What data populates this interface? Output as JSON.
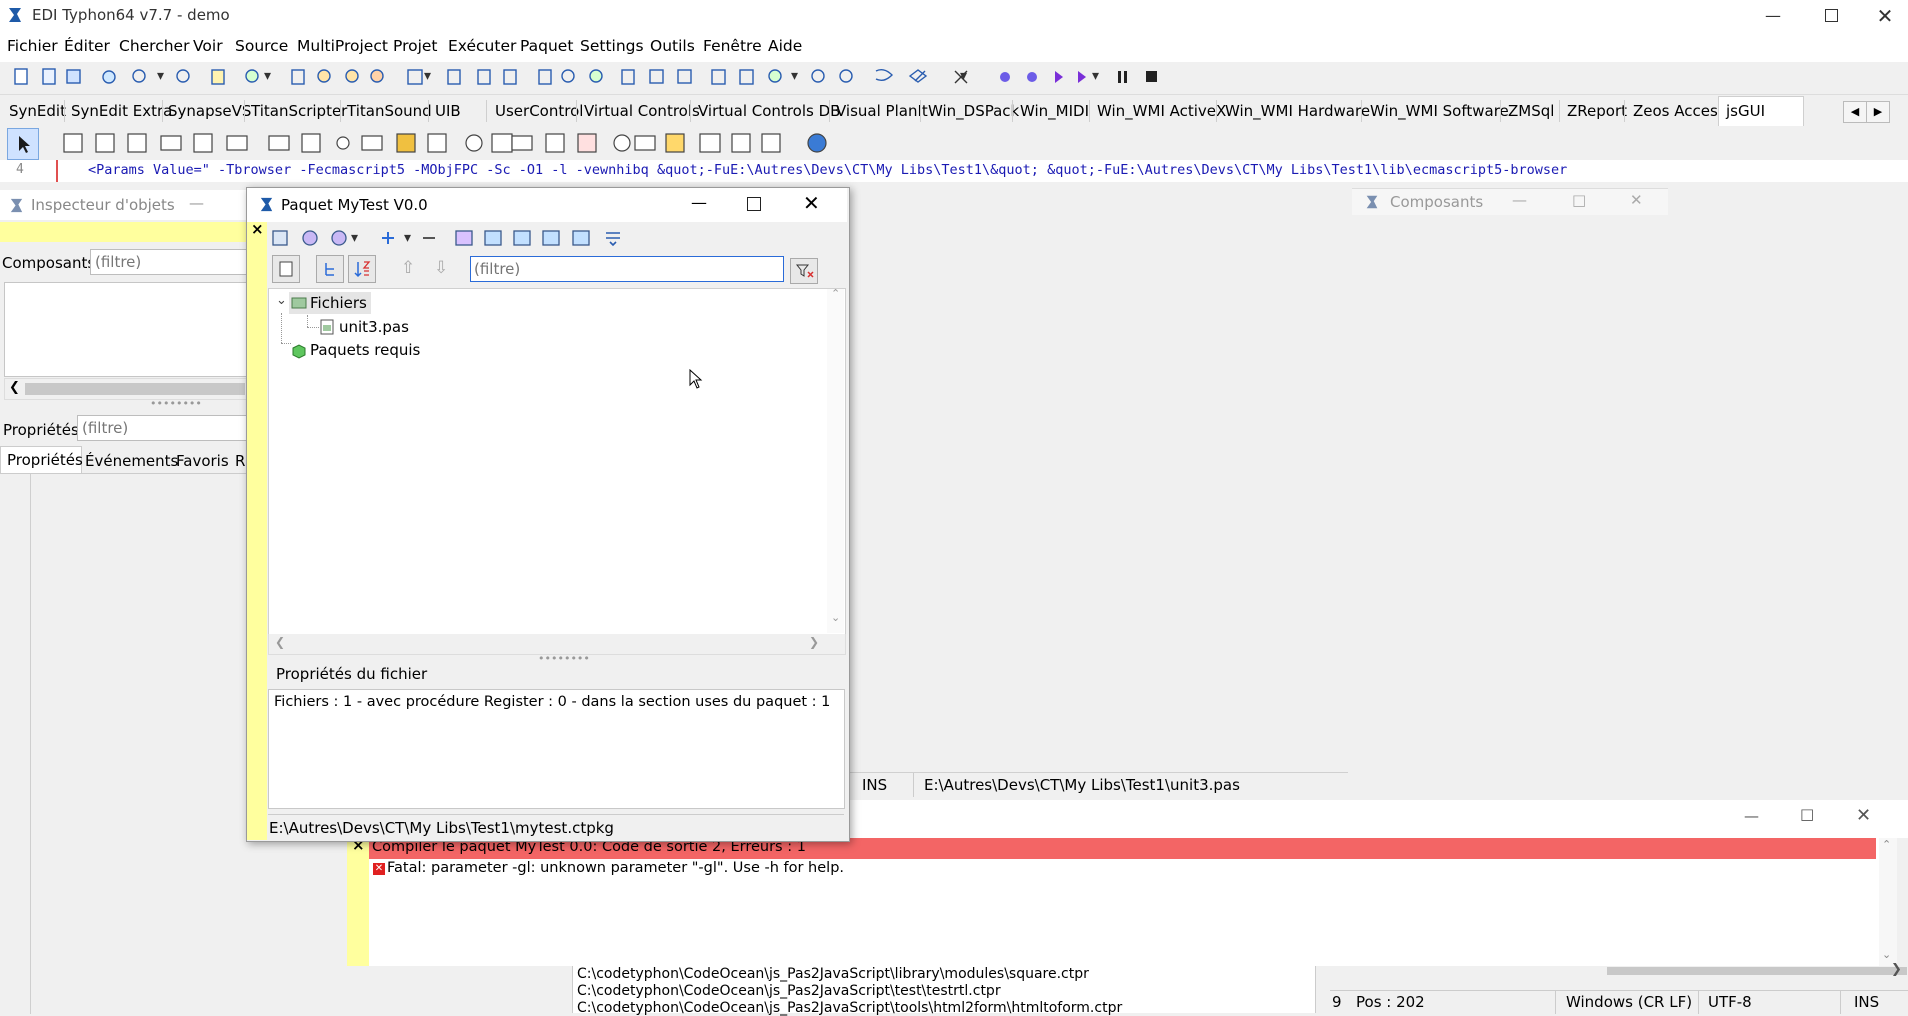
{
  "app": {
    "title": "EDI Typhon64 v7.7 - demo"
  },
  "menu": [
    "Fichier",
    "Éditer",
    "Chercher",
    "Voir",
    "Source",
    "MultiProject",
    "Projet",
    "Exécuter",
    "Paquet",
    "Settings",
    "Outils",
    "Fenêtre",
    "Aide"
  ],
  "palette_tabs": [
    "SynEdit",
    "SynEdit Extra",
    "SynapseVS",
    "TitanScripter",
    "TitanSound",
    "UIB",
    "UserControl",
    "Virtual Controls",
    "Virtual Controls DB",
    "Visual PlanIt",
    "Win_DSPack",
    "Win_MIDI",
    "Win_WMI ActiveX",
    "Win_WMI Hardware",
    "Win_WMI Software",
    "ZMSql",
    "ZReport",
    "Zeos Access",
    "jsGUI"
  ],
  "editor": {
    "line_no": "4",
    "line_text": "<Params Value=\" -Tbrowser -Fecmascript5 -MObjFPC -Sc -O1 -l -vewnhibq &quot;-FuE:\\Autres\\Devs\\CT\\My Libs\\Test1\\&quot; &quot;-FuE:\\Autres\\Devs\\CT\\My Libs\\Test1\\lib\\ecmascript5-browser"
  },
  "inspector": {
    "title": "Inspecteur d'objets",
    "components_label": "Composants",
    "components_placeholder": "(filtre)",
    "properties_label": "Propriétés",
    "properties_placeholder": "(filtre)",
    "tabs": [
      "Propriétés",
      "Événements",
      "Favoris",
      "R"
    ]
  },
  "composants_window": {
    "title": "Composants"
  },
  "package": {
    "title": "Paquet MyTest V0.0",
    "filter_placeholder": "(filtre)",
    "tree": {
      "files_label": "Fichiers",
      "file_item": "unit3.pas",
      "required_label": "Paquets requis"
    },
    "props_title": "Propriétés du fichier",
    "props_text": "Fichiers : 1 - avec procédure Register : 0 - dans la section uses du paquet : 1",
    "path": "E:\\Autres\\Devs\\CT\\My Libs\\Test1\\mytest.ctpkg"
  },
  "editor_status": {
    "mode": "INS",
    "path": "E:\\Autres\\Devs\\CT\\My Libs\\Test1\\unit3.pas"
  },
  "messages": {
    "error_line": "Compiler le paquet MyTest 0.0: Code de sortie 2, Erreurs : 1",
    "fatal_line": "Fatal: parameter -gl: unknown parameter \"-gl\". Use -h for help."
  },
  "recent_files": [
    "C:\\codetyphon\\CodeOcean\\js_Pas2JavaScript\\library\\modules\\square.ctpr",
    "C:\\codetyphon\\CodeOcean\\js_Pas2JavaScript\\test\\testrtl.ctpr",
    "C:\\codetyphon\\CodeOcean\\js_Pas2JavaScript\\tools\\html2form\\htmltoform.ctpr"
  ],
  "bottom_status": {
    "col_fragment": "9",
    "pos": "Pos : 202",
    "eol": "Windows (CR LF)",
    "encoding": "UTF-8",
    "mode": "INS"
  },
  "colors": {
    "yellow_band": "#ffff9e",
    "error_bar": "#f36565",
    "editor_text": "#1a1ab3"
  }
}
